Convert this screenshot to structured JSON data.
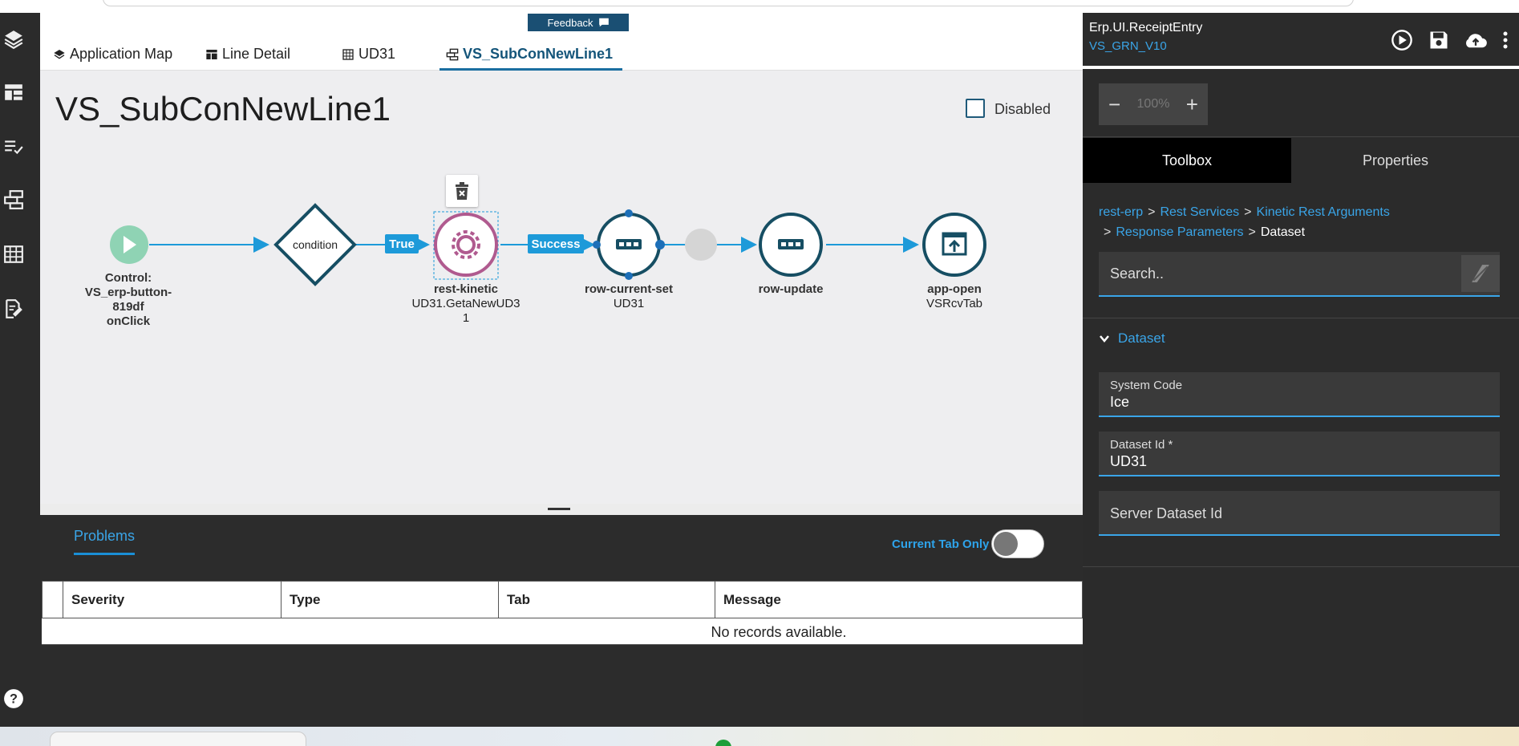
{
  "tabs": [
    {
      "label": "Application Map",
      "icon": "layers-icon"
    },
    {
      "label": "Line Detail",
      "icon": "table-icon"
    },
    {
      "label": "UD31",
      "icon": "grid-icon"
    },
    {
      "label": "VS_SubConNewLine1",
      "icon": "workflow-icon",
      "active": true
    }
  ],
  "feedback": {
    "label": "Feedback"
  },
  "canvas": {
    "title": "VS_SubConNewLine1",
    "disabled_label": "Disabled",
    "disabled_checked": false
  },
  "flow": {
    "nodes": [
      {
        "id": "trigger",
        "type": "event-trigger",
        "name": "Control:",
        "lines": [
          "VS_erp-button-",
          "819df",
          "onClick"
        ]
      },
      {
        "id": "condition",
        "type": "condition",
        "name": "condition"
      },
      {
        "id": "rest",
        "type": "rest-kinetic",
        "name": "rest-kinetic",
        "lines": [
          "UD31.GetaNewUD3",
          "1"
        ],
        "selected": true
      },
      {
        "id": "rcs",
        "type": "row-current-set",
        "name": "row-current-set",
        "lines": [
          "UD31"
        ]
      },
      {
        "id": "ru",
        "type": "row-update",
        "name": "row-update",
        "lines": []
      },
      {
        "id": "ao",
        "type": "app-open",
        "name": "app-open",
        "lines": [
          "VSRcvTab"
        ]
      }
    ],
    "edge_labels": {
      "true": "True",
      "success": "Success"
    }
  },
  "problems": {
    "tab_label": "Problems",
    "current_tab_only_label": "Current Tab Only",
    "current_tab_only_on": false,
    "columns": [
      "",
      "Severity",
      "Type",
      "Tab",
      "Message"
    ],
    "empty_text": "No records available."
  },
  "right_panel": {
    "app_name": "Erp.UI.ReceiptEntry",
    "version": "VS_GRN_V10",
    "zoom": {
      "value": "100%",
      "minus": "−",
      "plus": "+"
    },
    "tabs": {
      "toolbox": "Toolbox",
      "properties": "Properties"
    },
    "breadcrumb": {
      "items": [
        "rest-erp",
        "Rest Services",
        "Kinetic Rest Arguments",
        "Response Parameters"
      ],
      "current": "Dataset",
      "sep": ">"
    },
    "search": {
      "placeholder": "Search.."
    },
    "section": "Dataset",
    "fields": [
      {
        "label": "System Code",
        "value": "Ice"
      },
      {
        "label": "Dataset Id *",
        "value": "UD31"
      },
      {
        "label": "",
        "placeholder": "Server Dataset Id"
      }
    ]
  },
  "colors": {
    "accent": "#1d9ad9",
    "node_teal": "#164e63",
    "selected_node": "#b05a8f",
    "trigger_green": "#8fd3b4"
  }
}
